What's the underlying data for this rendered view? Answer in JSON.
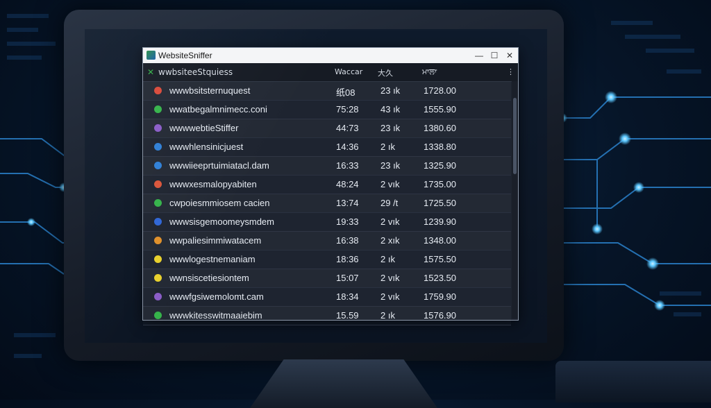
{
  "window": {
    "title": "WebsiteSniffer",
    "minimize_glyph": "—",
    "maximize_glyph": "☐",
    "close_glyph": "✕"
  },
  "header": {
    "name": "wwbsiteeStquiess",
    "time": "Waccar",
    "size": "大久",
    "value": "ਮਾਲਾ",
    "menu_glyph": "⋮"
  },
  "rows": [
    {
      "name": "wwwbsitsternuquest",
      "time": "纸08",
      "size": "23 ık",
      "value": "1728.00",
      "dot_color": "#d94a3a"
    },
    {
      "name": "wwatbegalmnimecc.coni",
      "time": "75:28",
      "size": "43 ık",
      "value": "1555.90",
      "dot_color": "#35b34a"
    },
    {
      "name": "wwwwebtieStiffer",
      "time": "44:73",
      "size": "23 ık",
      "value": "1380.60",
      "dot_color": "#8a5cc7"
    },
    {
      "name": "wwwhlensinicjuest",
      "time": "14:36",
      "size": "2 ık",
      "value": "1338.80",
      "dot_color": "#2f7fd6"
    },
    {
      "name": "wwwiieeprtuimiatacl.dam",
      "time": "16:33",
      "size": "23 ık",
      "value": "1325.90",
      "dot_color": "#2f7fd6"
    },
    {
      "name": "wwwxesmalopyabiten",
      "time": "48:24",
      "size": "2 vık",
      "value": "1735.00",
      "dot_color": "#d9553a"
    },
    {
      "name": "cwpoiesmmiosem cacien",
      "time": "13:74",
      "size": "29 /t",
      "value": "1725.50",
      "dot_color": "#35b34a"
    },
    {
      "name": "wwwsisgemoomeysmdem",
      "time": "19:33",
      "size": "2 vık",
      "value": "1239.90",
      "dot_color": "#2f66d6"
    },
    {
      "name": "wwpaliesimmiwatacem",
      "time": "16:38",
      "size": "2 xık",
      "value": "1348.00",
      "dot_color": "#e0902a"
    },
    {
      "name": "wwwlogestnemaniam",
      "time": "18:36",
      "size": "2 ık",
      "value": "1575.50",
      "dot_color": "#e8d02c"
    },
    {
      "name": "wwnsiscetiesiontem",
      "time": "15:07",
      "size": "2 vık",
      "value": "1523.50",
      "dot_color": "#e8d02c"
    },
    {
      "name": "wwwfgsiwemolomt.cam",
      "time": "18:34",
      "size": "2 vık",
      "value": "1759.90",
      "dot_color": "#8a5cc7"
    },
    {
      "name": "wwwkitesswitmaaiebim",
      "time": "15.59",
      "size": "2 ık",
      "value": "1576.90",
      "dot_color": "#35b34a"
    }
  ]
}
